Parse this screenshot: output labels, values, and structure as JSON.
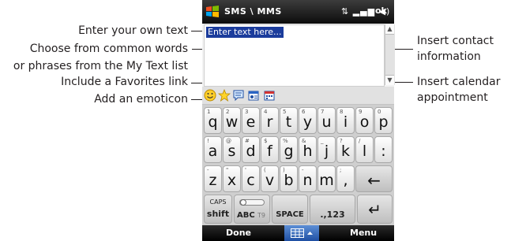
{
  "callouts": {
    "enter_text": "Enter your own text",
    "choose_common_1": "Choose from common words",
    "choose_common_2": "or phrases from the My Text list",
    "favorites_link": "Include a Favorites link",
    "emoticon": "Add an emoticon",
    "contact_1": "Insert contact",
    "contact_2": "information",
    "calendar_1": "Insert calendar",
    "calendar_2": "appointment"
  },
  "titlebar": {
    "title": "SMS \\ MMS",
    "status": "⇅ ▂▄▆ ◀)",
    "ok_label": "ok"
  },
  "message": {
    "placeholder": "Enter text here..."
  },
  "keyboard": {
    "row1": [
      {
        "sub": "1",
        "main": "q"
      },
      {
        "sub": "2",
        "main": "w"
      },
      {
        "sub": "3",
        "main": "e"
      },
      {
        "sub": "4",
        "main": "r"
      },
      {
        "sub": "5",
        "main": "t"
      },
      {
        "sub": "6",
        "main": "y"
      },
      {
        "sub": "7",
        "main": "u"
      },
      {
        "sub": "8",
        "main": "i"
      },
      {
        "sub": "9",
        "main": "o"
      },
      {
        "sub": "0",
        "main": "p"
      }
    ],
    "row2": [
      {
        "sub": "!",
        "main": "a"
      },
      {
        "sub": "@",
        "main": "s"
      },
      {
        "sub": "#",
        "main": "d"
      },
      {
        "sub": "$",
        "main": "f"
      },
      {
        "sub": "%",
        "main": "g"
      },
      {
        "sub": "&",
        "main": "h"
      },
      {
        "sub": "_",
        "main": "j"
      },
      {
        "sub": "?",
        "main": "k"
      },
      {
        "sub": "/",
        "main": "l"
      },
      {
        "sub": "",
        "main": ":"
      }
    ],
    "row3": [
      {
        "sub": "-",
        "main": "z"
      },
      {
        "sub": "\"",
        "main": "x"
      },
      {
        "sub": "'",
        "main": "c"
      },
      {
        "sub": "(",
        "main": "v"
      },
      {
        "sub": ")",
        "main": "b"
      },
      {
        "sub": "-",
        "main": "n"
      },
      {
        "sub": "",
        "main": "m"
      },
      {
        "sub": ";",
        "main": ","
      }
    ],
    "backspace": "←",
    "caps_label": "CAPS",
    "shift_label": "shift",
    "abc_label": "ABC",
    "t9_label": "T9",
    "space_label": "SPACE",
    "num_label": ".,123",
    "enter": "↵"
  },
  "softkeys": {
    "left": "Done",
    "right": "Menu"
  }
}
